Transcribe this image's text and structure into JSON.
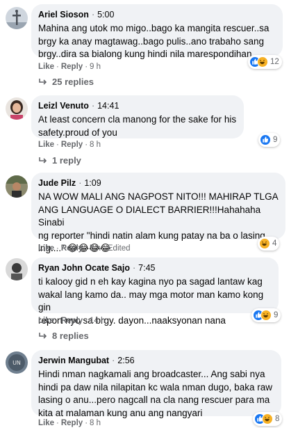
{
  "colors": {
    "bubble": "#f0f2f5",
    "meta_text": "#65676b",
    "like_blue": "#1877f2",
    "haha_yellow": "#f7b125"
  },
  "comments": [
    {
      "author": "Ariel Sioson",
      "time": "5:00",
      "text": "Mahina ang utok mo migo..bago ka mangita rescuer..sa\nbrgy ka anay magtawag..bago pulis..ano trabaho sang\nbrgy..dira sa bialong kung hindi nila marespondihan",
      "like_label": "Like",
      "reply_label": "Reply",
      "age": "9 h",
      "edited": "",
      "reactions": [
        "like-icon",
        "haha-icon"
      ],
      "reaction_count": "12",
      "replies": "25 replies"
    },
    {
      "author": "Leizl Venuto",
      "time": "14:41",
      "text": "At least concern cla manong for the sake for his\nsafety.proud of you",
      "like_label": "Like",
      "reply_label": "Reply",
      "age": "8 h",
      "edited": "",
      "reactions": [
        "like-icon"
      ],
      "reaction_count": "9",
      "replies": "1 reply"
    },
    {
      "author": "Jude Pilz",
      "time": "1:09",
      "text": "NA WOW MALI ANG NAGPOST NITO!!! MAHIRAP TLGA\nANG LANGUAGE O DIALECT BARRIER!!!Hahahaha Sinabi\nng reporter \"hindi natin alam kung patay na ba o lasing\nlng....\" 😂😂😂😂",
      "like_label": "Like",
      "reply_label": "Reply",
      "age": "5 h",
      "edited": "Edited",
      "reactions": [
        "haha-icon"
      ],
      "reaction_count": "4",
      "replies": ""
    },
    {
      "author": "Ryan John Ocate Sajo",
      "time": "7:45",
      "text": "ti kalooy gid n eh kay kagina nyo pa sagad lantaw kag\nwakal lang kamo da.. may mga motor man kamo kong gin\nreport nyo sa brgy. dayon...naaksyonan nana",
      "like_label": "Like",
      "reply_label": "Reply",
      "age": "14 h",
      "edited": "",
      "reactions": [
        "like-icon",
        "haha-icon"
      ],
      "reaction_count": "9",
      "replies": "8 replies"
    },
    {
      "author": "Jerwin Mangubat",
      "time": "2:56",
      "text": "Hindi nman nagkamali ang broadcaster... Ang sabi nya\nhindi pa daw nila nilapitan kc wala nman dugo, baka raw\nlasing o anu...pero nagcall na cla nang rescuer para ma\nkita at malaman kung anu ang nangyari",
      "like_label": "Like",
      "reply_label": "Reply",
      "age": "8 h",
      "edited": "",
      "reactions": [
        "like-icon",
        "haha-icon"
      ],
      "reaction_count": "8",
      "replies": ""
    }
  ]
}
